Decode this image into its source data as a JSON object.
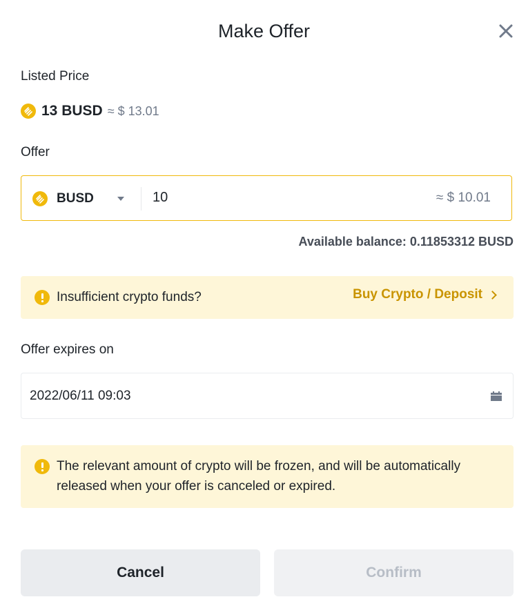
{
  "dialog": {
    "title": "Make Offer"
  },
  "listed_price": {
    "label": "Listed Price",
    "amount": "13 BUSD",
    "approx": "≈ $ 13.01"
  },
  "offer": {
    "label": "Offer",
    "token": "BUSD",
    "value": "10",
    "approx": "≈ $ 10.01",
    "balance": "Available balance: 0.11853312 BUSD"
  },
  "funds_notice": {
    "text": "Insufficient crypto funds?",
    "link": "Buy Crypto / Deposit"
  },
  "expiry": {
    "label": "Offer expires on",
    "value": "2022/06/11 09:03"
  },
  "frozen_notice": {
    "line1": "The relevant amount of crypto will be frozen, and will be automatically",
    "line2": "released when your offer is canceled or expired."
  },
  "actions": {
    "cancel": "Cancel",
    "confirm": "Confirm"
  },
  "colors": {
    "accent": "#f0b90b",
    "link": "#c99400",
    "notice_bg": "#fef6d8",
    "disabled_text": "#b7bdc6"
  },
  "icons": {
    "close": "close-icon",
    "coin": "busd-coin-icon",
    "warning": "warning-icon",
    "calendar": "calendar-icon",
    "caret": "caret-down-icon",
    "chevron": "chevron-right-icon"
  }
}
